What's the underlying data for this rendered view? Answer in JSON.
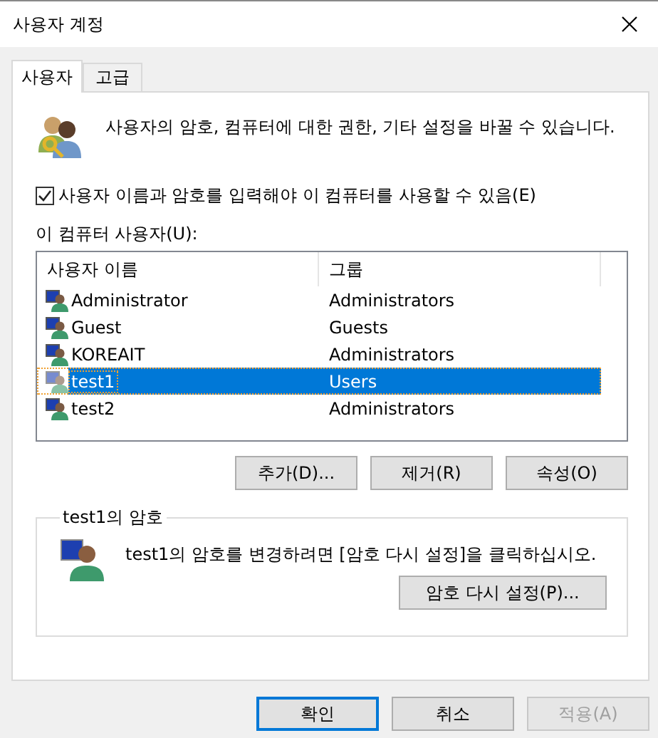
{
  "window": {
    "title": "사용자 계정"
  },
  "tabs": [
    {
      "label": "사용자",
      "selected": true
    },
    {
      "label": "고급",
      "selected": false
    }
  ],
  "description": "사용자의 암호, 컴퓨터에 대한 권한, 기타 설정을 바꿀 수 있습니다.",
  "require_login": {
    "label": "사용자 이름과 암호를 입력해야 이 컴퓨터를 사용할 수 있음(E)",
    "checked": true
  },
  "users_label": "이 컴퓨터 사용자(U):",
  "users_table": {
    "columns": [
      "사용자 이름",
      "그룹"
    ],
    "rows": [
      {
        "name": "Administrator",
        "group": "Administrators",
        "selected": false
      },
      {
        "name": "Guest",
        "group": "Guests",
        "selected": false
      },
      {
        "name": "KOREAIT",
        "group": "Administrators",
        "selected": false
      },
      {
        "name": "test1",
        "group": "Users",
        "selected": true
      },
      {
        "name": "test2",
        "group": "Administrators",
        "selected": false
      }
    ]
  },
  "list_buttons": [
    "추가(D)...",
    "제거(R)",
    "속성(O)"
  ],
  "password_group": {
    "title": "test1의 암호",
    "text": "test1의 암호를 변경하려면 [암호 다시 설정]을 클릭하십시오.",
    "button": "암호 다시 설정(P)..."
  },
  "dialog_buttons": [
    {
      "label": "확인",
      "kind": "default",
      "disabled": false
    },
    {
      "label": "취소",
      "kind": "normal",
      "disabled": false
    },
    {
      "label": "적용(A)",
      "kind": "normal",
      "disabled": true
    }
  ]
}
